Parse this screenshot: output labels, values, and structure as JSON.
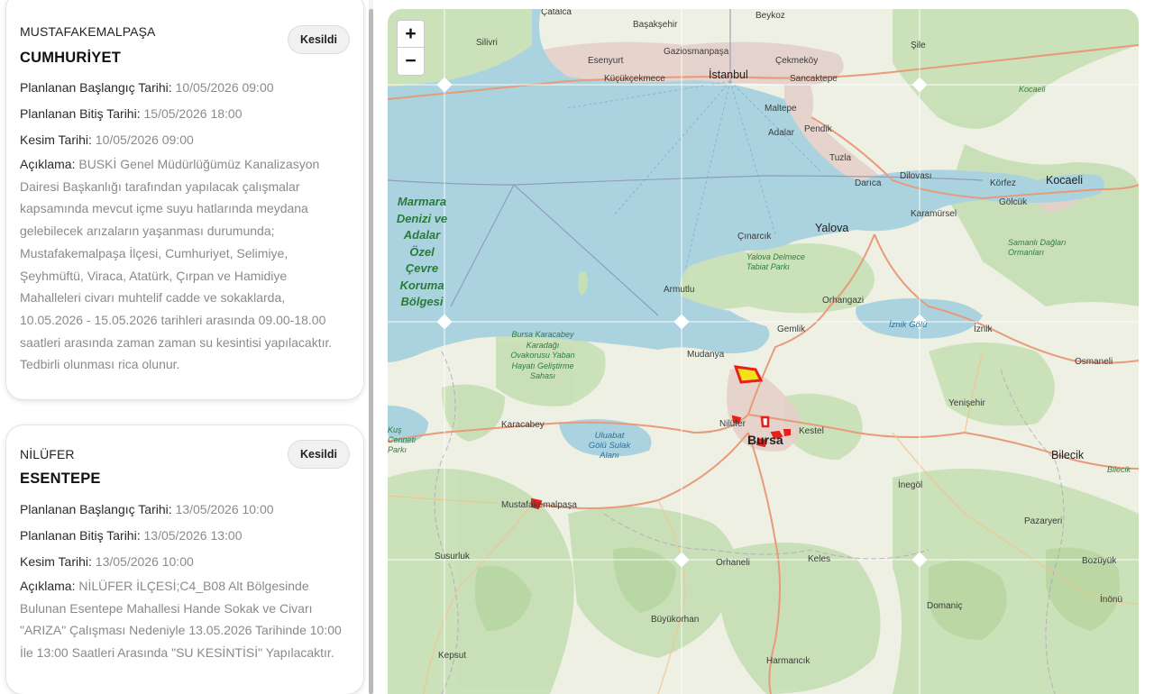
{
  "list": {
    "labels": {
      "start": "Planlanan Başlangıç Tarihi:",
      "end": "Planlanan Bitiş Tarihi:",
      "cut": "Kesim Tarihi:",
      "desc": "Açıklama:"
    },
    "items": [
      {
        "district": "MUSTAFAKEMALPAŞA",
        "neighborhood": "CUMHURİYET",
        "status": "Kesildi",
        "start": "10/05/2026 09:00",
        "end": "15/05/2026 18:00",
        "cut": "10/05/2026 09:00",
        "description": "BUSKİ Genel Müdürlüğümüz Kanalizasyon Dairesi Başkanlığı tarafından yapılacak çalışmalar kapsamında mevcut içme suyu hatlarında meydana gelebilecek arızaların yaşanması durumunda; Mustafakemalpaşa İlçesi, Cumhuriyet, Selimiye, Şeyhmüftü, Viraca, Atatürk, Çırpan ve Hamidiye Mahalleleri civarı muhtelif cadde ve sokaklarda, 10.05.2026 - 15.05.2026 tarihleri arasında 09.00-18.00 saatleri arasında zaman zaman su kesintisi yapılacaktır. Tedbirli olunması rica olunur."
      },
      {
        "district": "NİLÜFER",
        "neighborhood": "ESENTEPE",
        "status": "Kesildi",
        "start": "13/05/2026 10:00",
        "end": "13/05/2026 13:00",
        "cut": "13/05/2026 10:00",
        "description": "NİLÜFER İLÇESİ;C4_B08 Alt Bölgesinde Bulunan Esentepe Mahallesi Hande Sokak ve Civarı \"ARIZA\" Çalışması Nedeniyle 13.05.2026 Tarihinde 10:00 İle 13:00 Saatleri Arasında \"SU KESİNTİSİ\" Yapılacaktır."
      }
    ]
  },
  "map": {
    "zoom_in": "+",
    "zoom_out": "−",
    "marine_area": "Marmara Denizi ve Adalar Özel Çevre Koruma Bölgesi",
    "places": {
      "catalca": "Çatalca",
      "beykoz": "Beykoz",
      "silivri": "Silivri",
      "basaksehir": "Başakşehir",
      "esenyurt": "Esenyurt",
      "gaziosmanpasa": "Gaziosmanpaşa",
      "cekmekoy": "Çekmeköy",
      "sile": "Şile",
      "kucukcekmece": "Küçükçekmece",
      "istanbul": "İstanbul",
      "sancaktepe": "Sancaktepe",
      "kocaeli_region": "Kocaeli",
      "maltepe": "Maltepe",
      "adalar": "Adalar",
      "pendik": "Pendik",
      "tuzla": "Tuzla",
      "darica": "Darıca",
      "dilovasi": "Dilovası",
      "korfez": "Körfez",
      "kocaeli": "Kocaeli",
      "karamursel": "Karamürsel",
      "golcuk": "Gölcük",
      "yalova": "Yalova",
      "cinarcik": "Çınarcık",
      "yalova_park": "Yalova Delmece Tabiat Parkı",
      "samanli": "Samanlı Dağları Ormanları",
      "armutlu": "Armutlu",
      "orhangazi": "Orhangazi",
      "gemlik": "Gemlik",
      "iznik_golu": "İznik Gölü",
      "iznik": "İznik",
      "osmaneli": "Osmaneli",
      "mudanya": "Mudanya",
      "karacabey_forest": "Bursa Karacabey Karadağı Ovakorusu Yaban Hayatı Geliştirme Sahası",
      "yenisehir": "Yenişehir",
      "karacabey": "Karacabey",
      "nilufer": "Nilüfer",
      "kestel": "Kestel",
      "bursa": "Bursa",
      "uluabat": "Uluabat Gölü Sulak Alanı",
      "bilecik": "Bilecik",
      "bilecik2": "Bilecik",
      "inegol": "İnegöl",
      "mustafakemalpasa": "Mustafakemalpaşa",
      "pazaryeri": "Pazaryeri",
      "susurluk": "Susurluk",
      "orhaneli": "Orhaneli",
      "keles": "Keles",
      "bozuyuk": "Bozüyük",
      "domanic": "Domaniç",
      "buyukorhan": "Büyükorhan",
      "kepsut": "Kepsut",
      "harmancik": "Harmancık",
      "inonu": "İnönü",
      "manyas_park": "Kuş Cenneti Parkı"
    }
  }
}
